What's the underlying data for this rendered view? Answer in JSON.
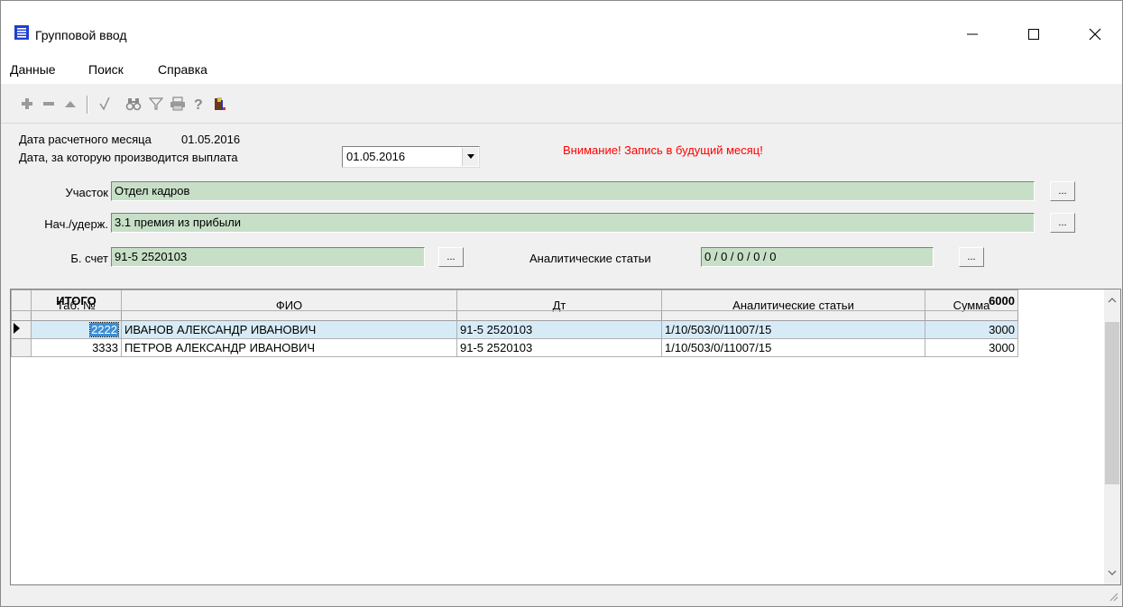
{
  "window": {
    "title": "Групповой ввод"
  },
  "menu": [
    "Данные",
    "Поиск",
    "Справка"
  ],
  "toolbar": {
    "icons": [
      "plus-icon",
      "minus-icon",
      "up-icon",
      "check-icon",
      "binoculars-icon",
      "filter-icon",
      "print-icon",
      "help-icon",
      "exit-icon"
    ]
  },
  "form": {
    "calc_month_label": "Дата расчетного месяца",
    "calc_month_value": "01.05.2016",
    "pay_date_label": "Дата, за которую производится выплата",
    "pay_date_value": "01.05.2016",
    "warning": "Внимание! Запись в будущий месяц!",
    "section_label": "Участок",
    "section_value": "Отдел кадров",
    "accrual_label": "Нач./удерж.",
    "accrual_value": "3.1 премия из прибыли",
    "account_label": "Б. счет",
    "account_value": "91-5 2520103",
    "analytics_label": "Аналитические статьи",
    "analytics_value": "0 / 0 / 0 / 0 / 0",
    "dots": "..."
  },
  "grid": {
    "columns": [
      "Таб. №",
      "ФИО",
      "Дт",
      "Аналитические статьи",
      "Сумма"
    ],
    "rows": [
      {
        "tab": "2222",
        "fio": "ИВАНОВ АЛЕКСАНДР ИВАНОВИЧ",
        "dt": "91-5  2520103",
        "analytics": "1/10/503/0/11007/15",
        "sum": "3000"
      },
      {
        "tab": "3333",
        "fio": "ПЕТРОВ АЛЕКСАНДР ИВАНОВИЧ",
        "dt": "91-5  2520103",
        "analytics": "1/10/503/0/11007/15",
        "sum": "3000"
      }
    ],
    "total_label": "ИТОГО",
    "total_sum": "6000"
  },
  "colors": {
    "field_bg": "#c7dfc7",
    "warning": "#ff0000",
    "selected_row": "#d7ebf7"
  }
}
